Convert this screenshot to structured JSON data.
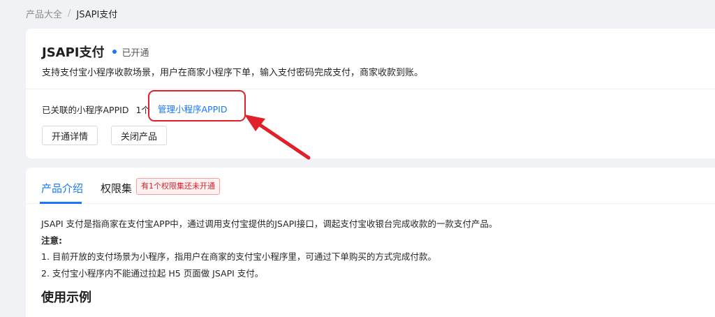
{
  "breadcrumb": {
    "root": "产品大全",
    "separator": "/",
    "current": "JSAPI支付"
  },
  "product": {
    "title": "JSAPI支付",
    "status": "已开通",
    "description": "支持支付宝小程序收款场景，用户在商家小程序下单，输入支付密码完成支付，商家收款到账。"
  },
  "appid": {
    "label": "已关联的小程序APPID",
    "count": "1个",
    "manage_link": "管理小程序APPID"
  },
  "buttons": {
    "details": "开通详情",
    "close": "关闭产品"
  },
  "tabs": {
    "intro": "产品介绍",
    "permissions": "权限集",
    "badge": "有1个权限集还未开通"
  },
  "content": {
    "line1": "JSAPI 支付是指商家在支付宝APP中，通过调用支付宝提供的JSAPI接口，调起支付宝收银台完成收款的一款支付产品。",
    "note_label": "注意:",
    "note1": "1. 目前开放的支付场景为小程序，指用户在商家的支付宝小程序里，可通过下单购买的方式完成付款。",
    "note2": "2. 支付宝小程序内不能通过拉起 H5 页面做 JSAPI 支付。",
    "section_title": "使用示例"
  },
  "colors": {
    "accent": "#1677ff",
    "annotation_red": "#e0202a",
    "background": "#f0f2f5"
  }
}
